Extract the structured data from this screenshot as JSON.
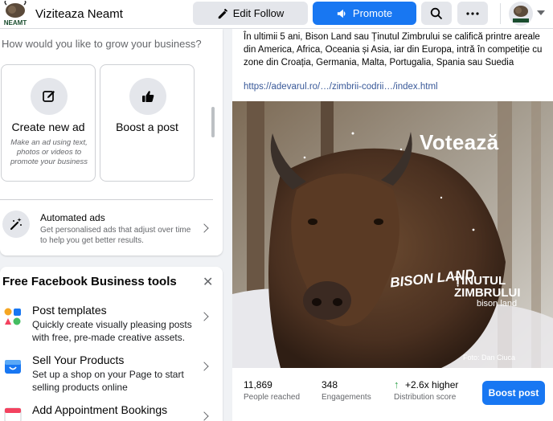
{
  "header": {
    "page_name": "Viziteaza Neamt",
    "logo_text": "NEAMT",
    "edit_follow_label": "Edit Follow",
    "promote_label": "Promote",
    "icons": {
      "edit": "pencil-icon",
      "promote": "megaphone-icon",
      "search": "search-icon",
      "more": "more-icon",
      "profile": "profile-avatar"
    }
  },
  "grow": {
    "question": "How would you like to grow your business?",
    "options": [
      {
        "title": "Create new ad",
        "desc": "Make an ad using text, photos or videos to promote your business",
        "icon": "edit-ad-icon"
      },
      {
        "title": "Boost a post",
        "desc": "",
        "icon": "thumbs-up-icon"
      }
    ],
    "automated": {
      "title": "Automated ads",
      "desc": "Get personalised ads that adjust over time to help you get better results.",
      "icon": "magic-wand-icon"
    }
  },
  "tools": {
    "title": "Free Facebook Business tools",
    "close_glyph": "✕",
    "items": [
      {
        "title": "Post templates",
        "desc": "Quickly create visually pleasing posts with free, pre-made creative assets.",
        "icon": "templates-icon"
      },
      {
        "title": "Sell Your Products",
        "desc": "Set up a shop on your Page to start selling products online",
        "icon": "shop-icon"
      },
      {
        "title": "Add Appointment Bookings",
        "desc": "",
        "icon": "calendar-icon"
      }
    ]
  },
  "post": {
    "text": "În ultimii 5 ani, Bison Land sau Ținutul Zimbrului se califică printre areale din America, Africa, Oceania și Asia, iar din Europa, intră în competiție cu zone din Croația, Germania, Malta, Portugalia, Spania sau Suedia",
    "link": "https://adevarul.ro/…/zimbrii-codrii…/index.html",
    "image": {
      "headline": "Votează",
      "brand_line1": "ȚINUTUL",
      "brand_line2": "ZIMBRULUI",
      "brand_sub": "bison land",
      "bison_mark": "BISON LAND",
      "credit": "Foto: Dan Ciuca"
    },
    "stats": [
      {
        "value": "11,869",
        "label": "People reached"
      },
      {
        "value": "348",
        "label": "Engagements"
      },
      {
        "value": "+2.6x higher",
        "label": "Distribution score"
      }
    ],
    "boost_label": "Boost post"
  },
  "colors": {
    "primary": "#1877f2",
    "background": "#f0f2f5",
    "secondary_button": "#e4e6eb",
    "positive": "#31a24c"
  }
}
